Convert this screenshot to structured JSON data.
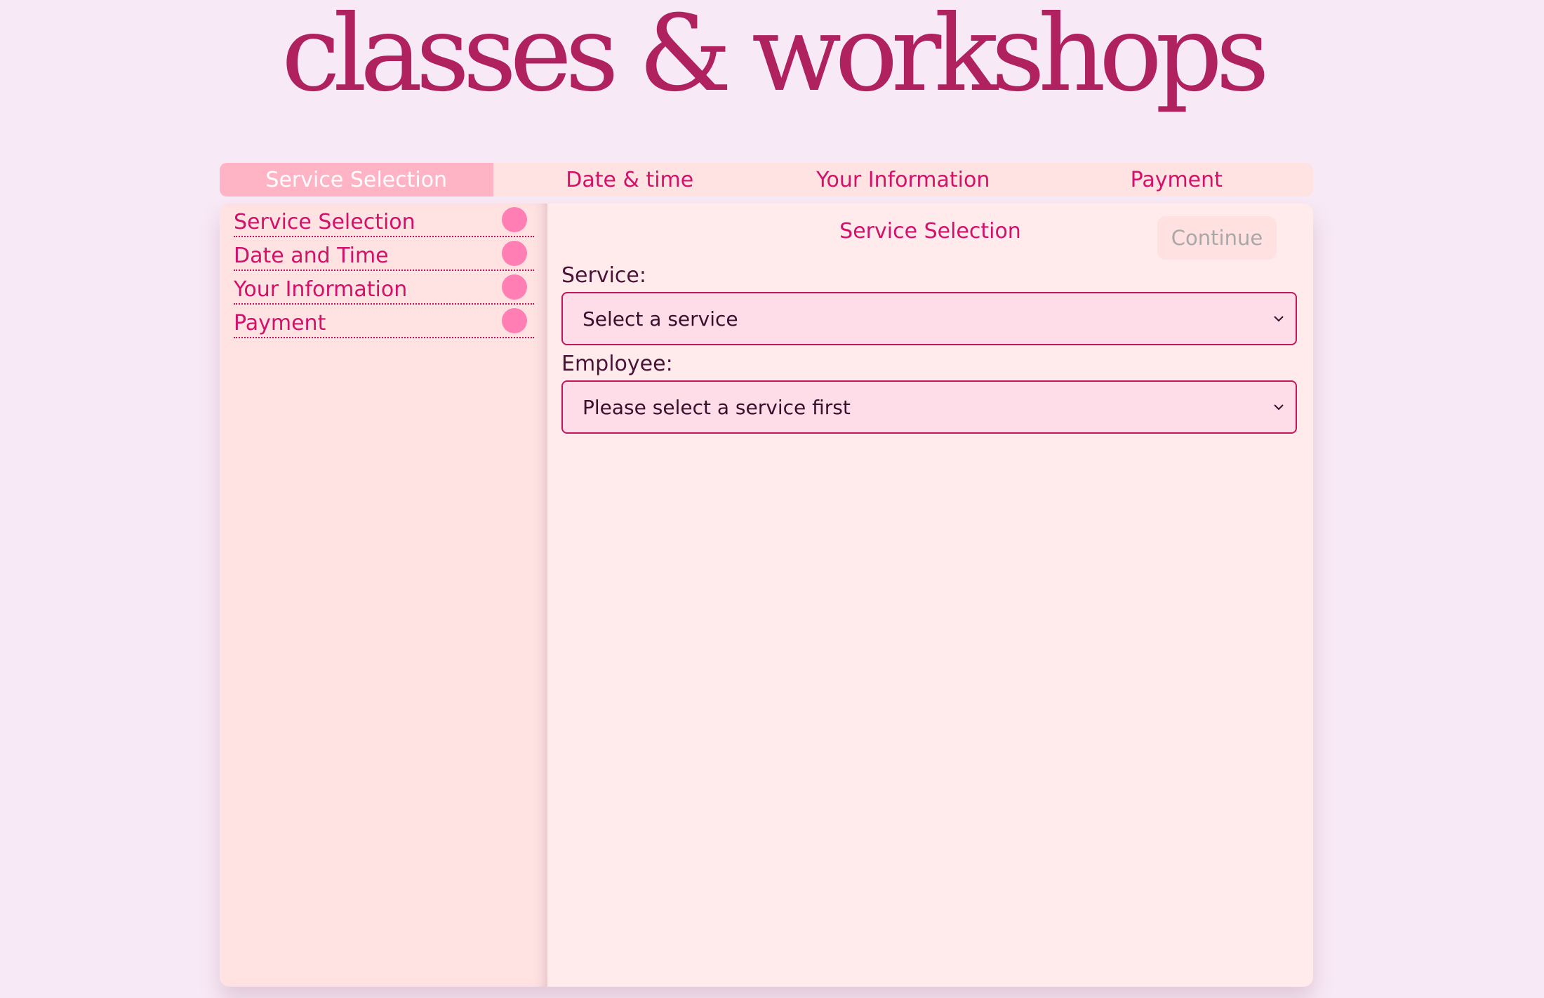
{
  "header": {
    "title": "classes & workshops"
  },
  "tabs": [
    {
      "label": "Service Selection",
      "active": true
    },
    {
      "label": "Date & time",
      "active": false
    },
    {
      "label": "Your Information",
      "active": false
    },
    {
      "label": "Payment",
      "active": false
    }
  ],
  "sidebar": {
    "items": [
      {
        "label": "Service Selection"
      },
      {
        "label": "Date and Time"
      },
      {
        "label": "Your Information"
      },
      {
        "label": "Payment"
      }
    ]
  },
  "main": {
    "heading": "Service Selection",
    "continue_label": "Continue",
    "service": {
      "label": "Service:",
      "selected": "Select a service"
    },
    "employee": {
      "label": "Employee:",
      "selected": "Please select a service first"
    }
  },
  "colors": {
    "background": "#f8e9f6",
    "accent": "#d3116a",
    "title": "#b0215f",
    "active_tab": "#ffb4c6",
    "dot": "#ff7eb3"
  },
  "icons": {
    "select_arrow": "chevron-down-icon",
    "step_indicator": "circle-icon"
  }
}
